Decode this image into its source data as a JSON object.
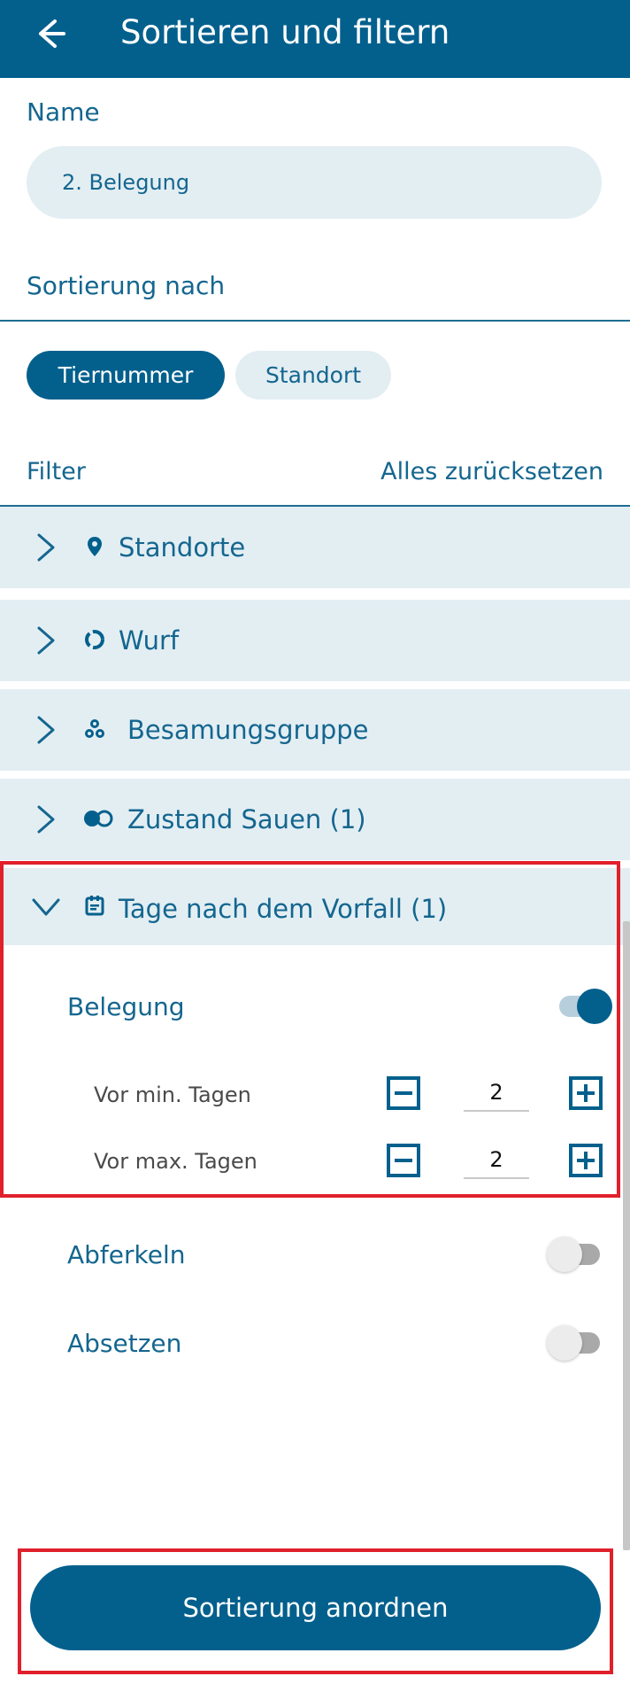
{
  "appbar": {
    "title": "Sortieren und filtern",
    "back_icon": "arrow-left-icon"
  },
  "name": {
    "label": "Name",
    "value": "2. Belegung"
  },
  "sort": {
    "label": "Sortierung nach",
    "chips": [
      {
        "label": "Tiernummer",
        "selected": true
      },
      {
        "label": "Standort",
        "selected": false
      }
    ]
  },
  "filter": {
    "label": "Filter",
    "reset_label": "Alles zurücksetzen",
    "sections": [
      {
        "label": "Standorte",
        "icon": "location-pin-icon",
        "expanded": false
      },
      {
        "label": "Wurf",
        "icon": "circle-dashed-icon",
        "expanded": false
      },
      {
        "label": "Besamungsgruppe",
        "icon": "pig-group-icon",
        "expanded": false
      },
      {
        "label": "Zustand Sauen (1)",
        "icon": "toggle-icon",
        "expanded": false
      },
      {
        "label": "Tage nach dem Vorfall (1)",
        "icon": "calendar-icon",
        "expanded": true
      }
    ]
  },
  "days": {
    "belegung": {
      "label": "Belegung",
      "enabled": true
    },
    "min": {
      "label": "Vor min. Tagen",
      "value": "2"
    },
    "max": {
      "label": "Vor max. Tagen",
      "value": "2"
    },
    "abferkeln": {
      "label": "Abferkeln",
      "enabled": false
    },
    "absetzen": {
      "label": "Absetzen",
      "enabled": false
    }
  },
  "cta": {
    "label": "Sortierung anordnen"
  },
  "colors": {
    "primary": "#03608d",
    "light": "#e3eef3",
    "highlight": "#e0202b"
  }
}
